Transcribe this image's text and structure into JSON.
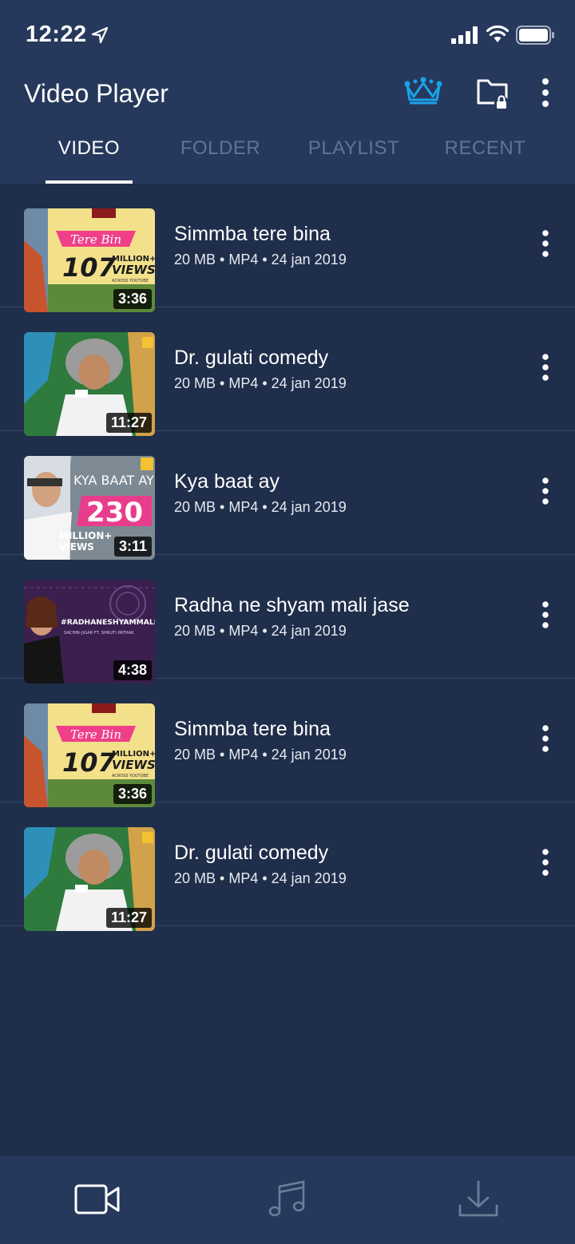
{
  "status": {
    "time": "12:22"
  },
  "app": {
    "title": "Video Player"
  },
  "tabs": [
    {
      "label": "VIDEO",
      "active": true
    },
    {
      "label": "FOLDER",
      "active": false
    },
    {
      "label": "PLAYLIST",
      "active": false
    },
    {
      "label": "RECENT",
      "active": false
    }
  ],
  "videos": [
    {
      "title": "Simmba tere bina",
      "meta": "20 MB  • MP4 • 24 jan 2019",
      "duration": "3:36",
      "thumb": "tere-bin"
    },
    {
      "title": "Dr. gulati comedy",
      "meta": "20 MB • MP4 • 24 jan 2019",
      "duration": "11:27",
      "thumb": "gulati"
    },
    {
      "title": "Kya baat ay",
      "meta": "20 MB • MP4 • 24 jan 2019",
      "duration": "3:11",
      "thumb": "kya-baat"
    },
    {
      "title": "Radha ne shyam mali jase",
      "meta": "20 MB • MP4 • 24 jan 2019",
      "duration": "4:38",
      "thumb": "radha"
    },
    {
      "title": "Simmba tere bina",
      "meta": "20 MB • MP4 • 24 jan 2019",
      "duration": "3:36",
      "thumb": "tere-bin"
    },
    {
      "title": "Dr. gulati comedy",
      "meta": "20 MB • MP4 • 24 jan 2019",
      "duration": "11:27",
      "thumb": "gulati"
    }
  ],
  "thumb_text": {
    "tere_bin_script": "Tere Bin",
    "tere_bin_big": "107",
    "tere_bin_small_1": "MILLION+",
    "tere_bin_small_2": "VIEWS",
    "tere_bin_small_3": "ACROSS YOUTUBE",
    "kya_title": "KYA BAAT AY",
    "kya_big": "230",
    "kya_small_1": "MILLION+",
    "kya_small_2": "VIEWS",
    "radha_tag": "#RADHANESHYAMMALIJASHE",
    "radha_credit": "SACHIN-JIGAR FT. SHRUTI PATHAK"
  },
  "bottom_nav": [
    {
      "icon": "video-camera-icon",
      "active": true
    },
    {
      "icon": "music-note-icon",
      "active": false
    },
    {
      "icon": "download-icon",
      "active": false
    }
  ],
  "colors": {
    "header_bg": "#26395c",
    "list_bg": "#1f2e4a",
    "accent_crown": "#1aa3e8",
    "tab_inactive": "#5f7596"
  }
}
